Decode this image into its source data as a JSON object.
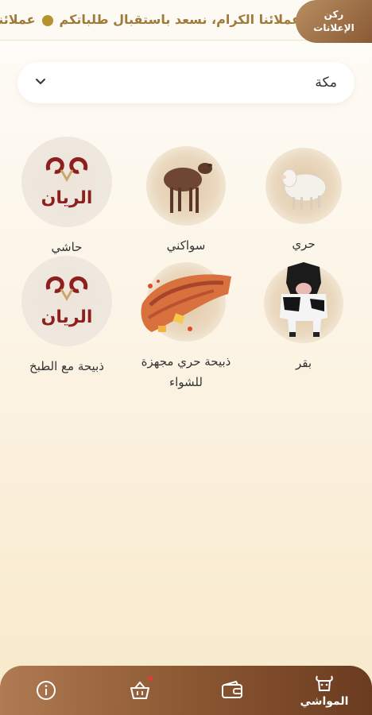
{
  "ticker": {
    "text_1": "عملائنا الكرام، نسعد باستقبال طلباتكم",
    "text_2": "عملائنا الكرام، نسعد باستقبال طلباتكم"
  },
  "ads_corner": {
    "line1": "ركن",
    "line2": "الإعلانات"
  },
  "city_select": {
    "value": "مكة"
  },
  "categories": [
    {
      "label": "حري",
      "icon": "white-sheep-image"
    },
    {
      "label": "سواكني",
      "icon": "brown-sheep-image"
    },
    {
      "label": "حاشي",
      "icon": "alrayan-logo"
    },
    {
      "label": "بقر",
      "icon": "cow-image"
    },
    {
      "label": "ذبيحة حري مجهزة للشواء",
      "icon": "grilled-lamb-image"
    },
    {
      "label": "ذبيحة مع الطبخ",
      "icon": "alrayan-logo"
    }
  ],
  "logo_text": "الريان",
  "bottom_nav": {
    "livestock_label": "المواشي",
    "items": [
      "info-icon",
      "basket-icon",
      "wallet-icon",
      "livestock-icon"
    ]
  },
  "colors": {
    "brand_brown": "#8c5833",
    "accent_gold": "#b8912f",
    "logo_red": "#8e1f1f"
  }
}
